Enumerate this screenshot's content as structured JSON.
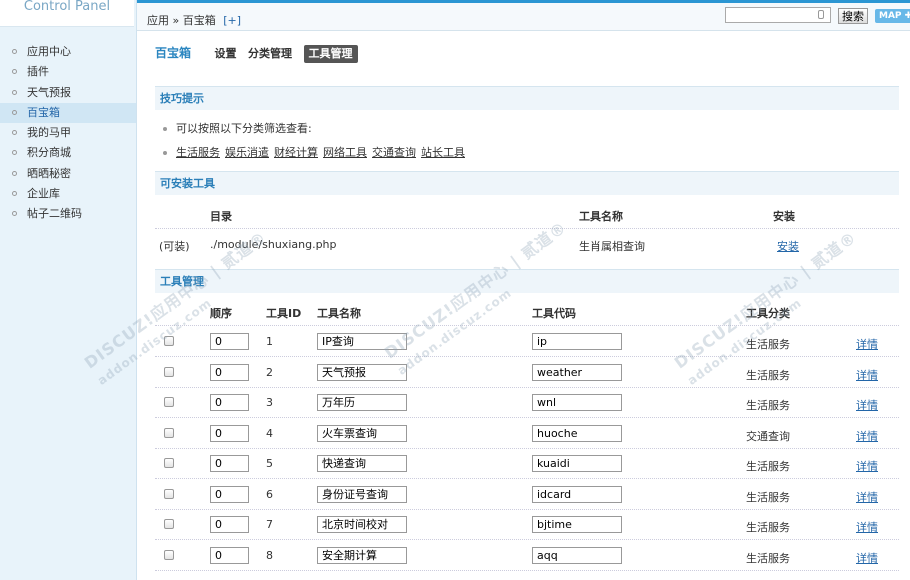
{
  "sidebar": {
    "title": "Control Panel",
    "items": [
      "应用中心",
      "插件",
      "天气预报",
      "百宝箱",
      "我的马甲",
      "积分商城",
      "晒晒秘密",
      "企业库",
      "帖子二维码"
    ],
    "active_index": 3
  },
  "header": {
    "breadcrumb": "应用 » 百宝箱",
    "plus": "[+]",
    "search_placeholder": "",
    "search_button": "搜索",
    "map_button": "MAP ✚"
  },
  "page_tabs": {
    "title": "百宝箱",
    "tabs": [
      "设置",
      "分类管理",
      "工具管理"
    ],
    "current_index": 2
  },
  "tips": {
    "header": "技巧提示",
    "line1": "可以按照以下分类筛选查看:",
    "categories": [
      "生活服务",
      "娱乐消遣",
      "财经计算",
      "网络工具",
      "交通查询",
      "站长工具"
    ]
  },
  "installable": {
    "header": "可安装工具",
    "col_dir": "目录",
    "col_name": "工具名称",
    "col_install": "安装",
    "row": {
      "status": "(可装)",
      "dir": "./module/shuxiang.php",
      "name": "生肖属相查询",
      "action": "安装"
    }
  },
  "manage": {
    "header": "工具管理",
    "col_order": "顺序",
    "col_id": "工具ID",
    "col_name": "工具名称",
    "col_code": "工具代码",
    "col_cat": "工具分类",
    "detail_label": "详情",
    "rows": [
      {
        "order": "0",
        "id": "1",
        "name": "IP查询",
        "code": "ip",
        "category": "生活服务"
      },
      {
        "order": "0",
        "id": "2",
        "name": "天气预报",
        "code": "weather",
        "category": "生活服务"
      },
      {
        "order": "0",
        "id": "3",
        "name": "万年历",
        "code": "wnl",
        "category": "生活服务"
      },
      {
        "order": "0",
        "id": "4",
        "name": "火车票查询",
        "code": "huoche",
        "category": "交通查询"
      },
      {
        "order": "0",
        "id": "5",
        "name": "快递查询",
        "code": "kuaidi",
        "category": "生活服务"
      },
      {
        "order": "0",
        "id": "6",
        "name": "身份证号查询",
        "code": "idcard",
        "category": "生活服务"
      },
      {
        "order": "0",
        "id": "7",
        "name": "北京时间校对",
        "code": "bjtime",
        "category": "生活服务"
      },
      {
        "order": "0",
        "id": "8",
        "name": "安全期计算",
        "code": "aqq",
        "category": "生活服务"
      }
    ]
  },
  "watermark": {
    "line1": "DISCUZ!应用中心 | 贰道®",
    "line2": "addon.discuz.com"
  }
}
